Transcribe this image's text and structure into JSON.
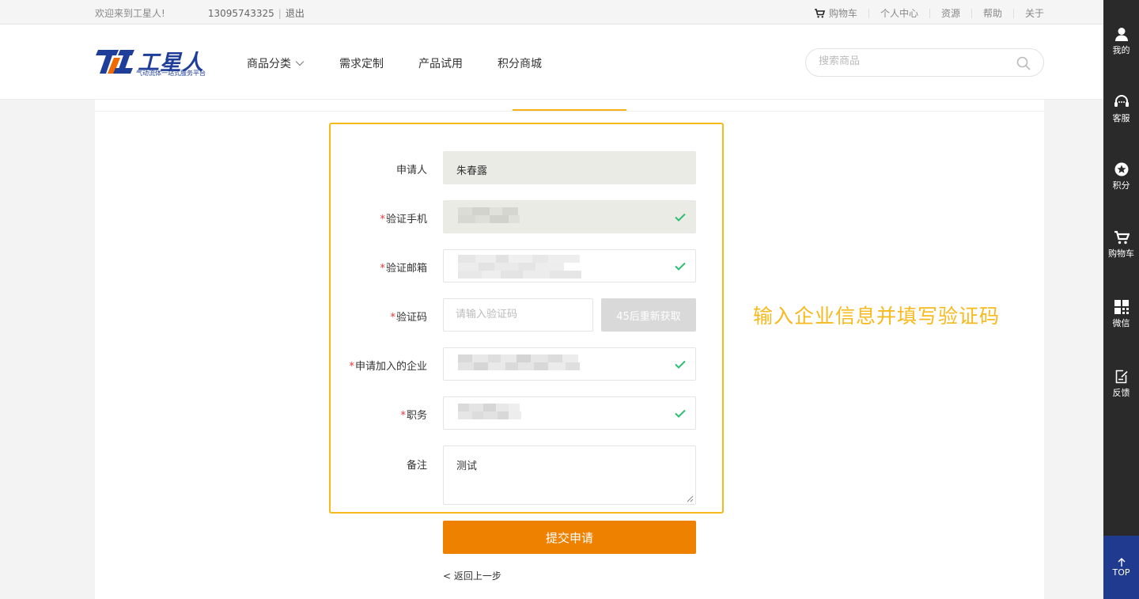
{
  "topbar": {
    "welcome": "欢迎来到工星人!",
    "phone": "13095743325",
    "separator": "|",
    "logout": "退出",
    "links": [
      "购物车",
      "个人中心",
      "资源",
      "帮助",
      "关于"
    ]
  },
  "header": {
    "logo_name": "工星人",
    "logo_slogan": "气动流体一站式服务平台",
    "nav": [
      {
        "label": "商品分类",
        "has_dropdown": true
      },
      {
        "label": "需求定制"
      },
      {
        "label": "产品试用"
      },
      {
        "label": "积分商城"
      }
    ],
    "search_placeholder": "搜索商品"
  },
  "form": {
    "applicant_label": "申请人",
    "applicant_value": "朱春露",
    "phone_label": "验证手机",
    "email_label": "验证邮箱",
    "code_label": "验证码",
    "code_placeholder": "请输入验证码",
    "code_button": "45后重新获取",
    "company_label": "申请加入的企业",
    "position_label": "职务",
    "remark_label": "备注",
    "remark_value": "测试",
    "required_mark": "*",
    "submit": "提交申请",
    "back": "< 返回上一步"
  },
  "annotation": "输入企业信息并填写验证码",
  "sidebar": {
    "items": [
      "我的",
      "客服",
      "积分",
      "购物车",
      "微信",
      "反馈"
    ],
    "top": "TOP"
  },
  "colors": {
    "brand_blue": "#1f3e9a",
    "accent_orange": "#ef8100",
    "highlight_yellow": "#f7b91c",
    "check_green": "#2fbf71",
    "sidebar_dark": "#2a2a2a",
    "top_button_blue": "#1f3a8f"
  }
}
